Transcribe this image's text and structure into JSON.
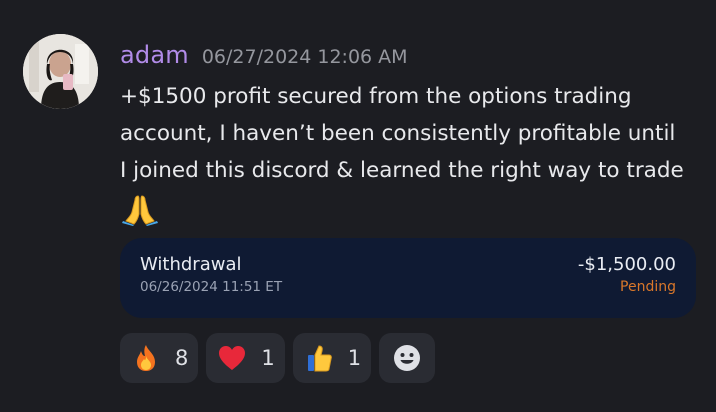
{
  "message": {
    "username": "adam",
    "timestamp": "06/27/2024 12:06 AM",
    "content_lines": [
      "+$1500 profit secured from the options trading",
      "account, I haven’t been consistently profitable until",
      "I joined this discord & learned the right way to trade"
    ],
    "content_emoji": "folded-hands"
  },
  "transaction": {
    "type": "Withdrawal",
    "date": "06/26/2024 11:51 ET",
    "amount": "-$1,500.00",
    "status": "Pending",
    "status_color": "#d9772a"
  },
  "reactions": [
    {
      "emoji": "fire",
      "count": "8"
    },
    {
      "emoji": "red-heart",
      "count": "1"
    },
    {
      "emoji": "thumbs-up",
      "count": "1"
    }
  ],
  "add_reaction_icon": "smiley-add-reaction",
  "colors": {
    "background": "#1c1d22",
    "username": "#b18be8",
    "card": "#0f1a33",
    "reaction_pill": "#2a2c33"
  }
}
